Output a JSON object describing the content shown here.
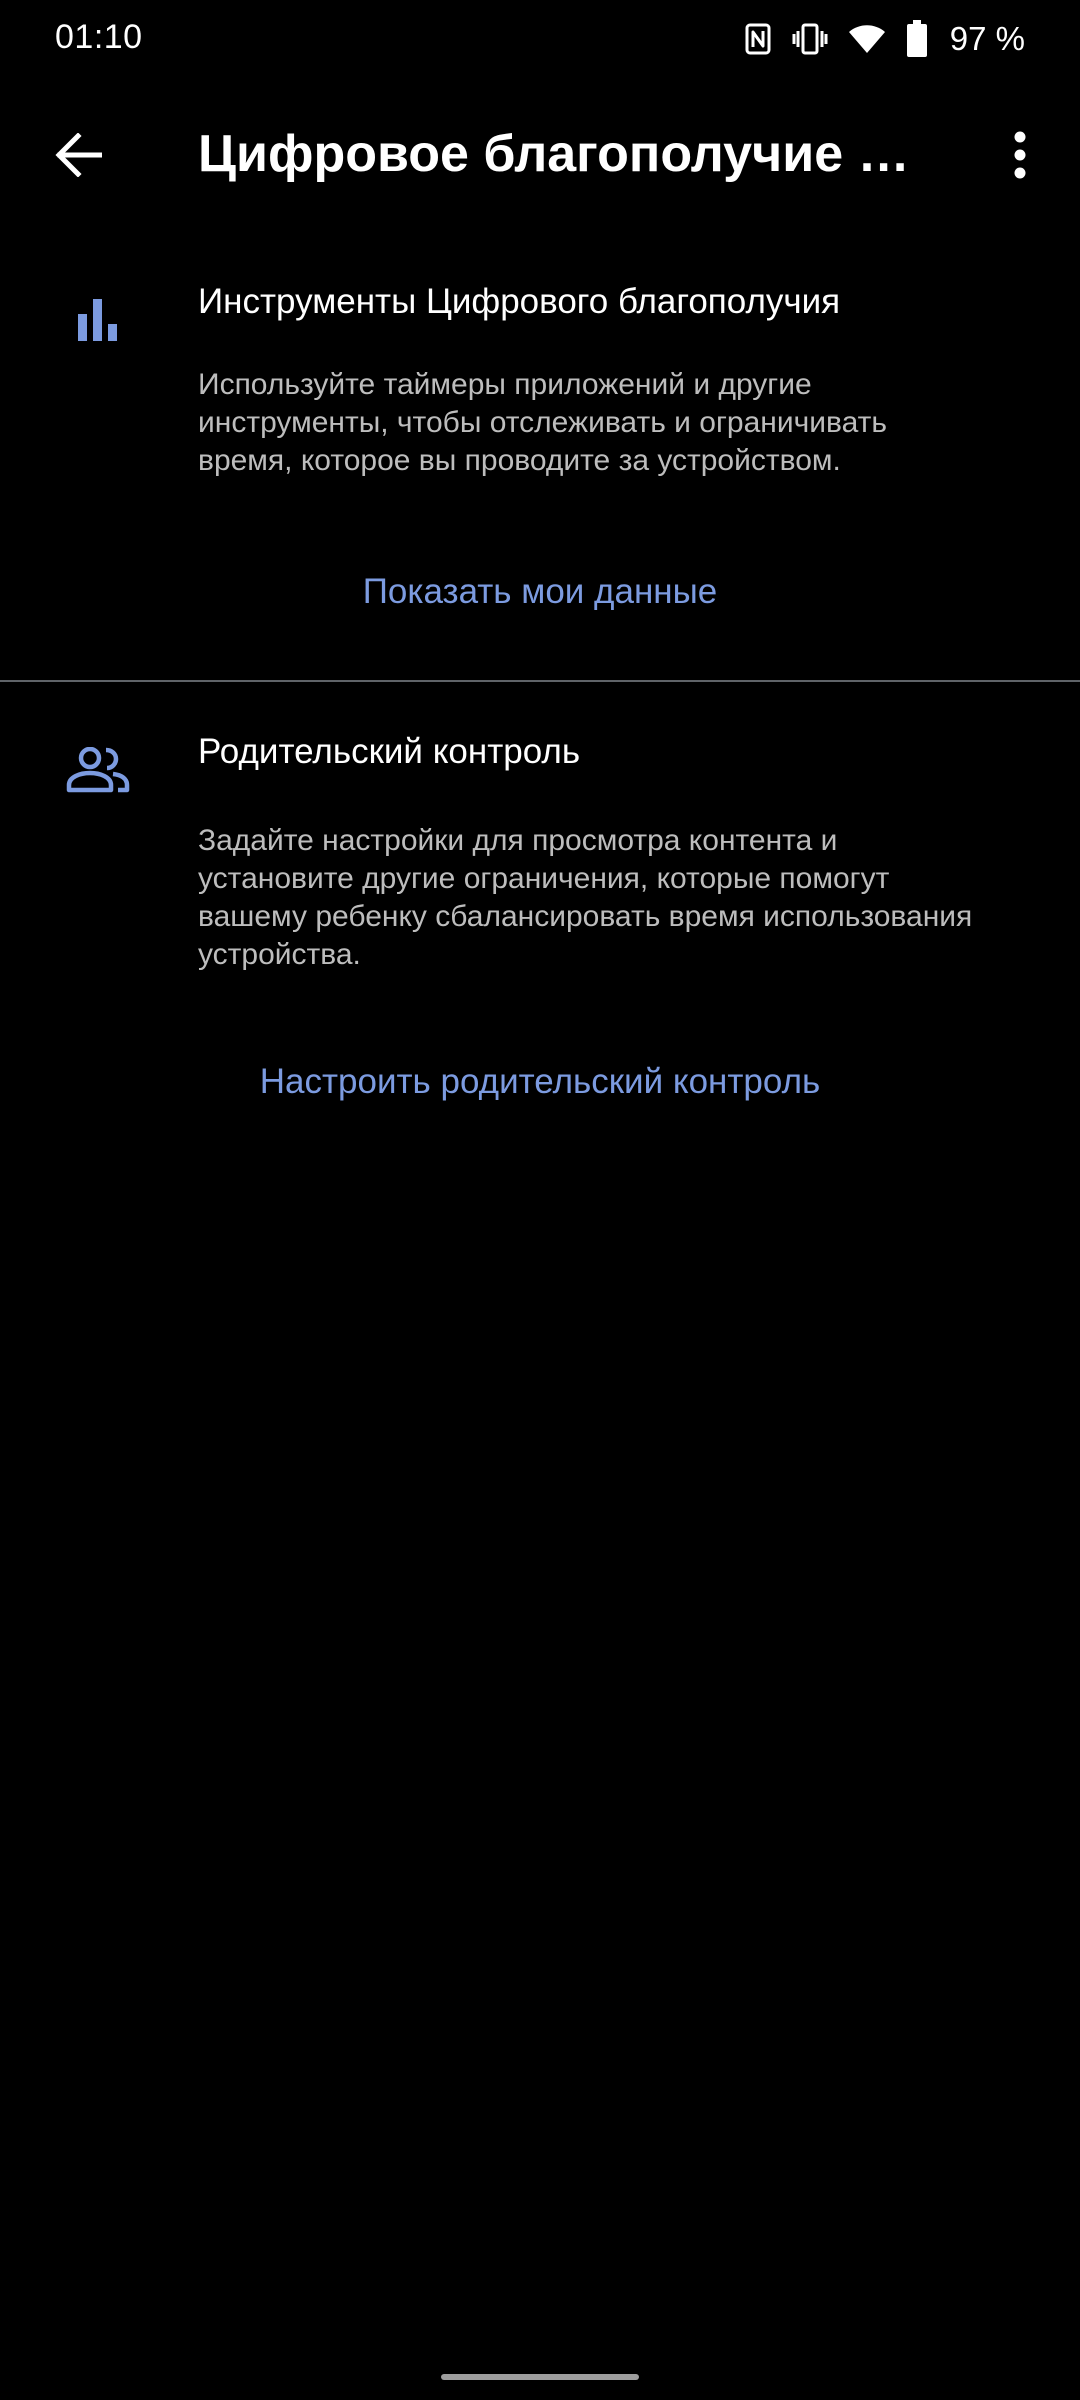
{
  "status_bar": {
    "time": "01:10",
    "battery_percent": "97 %",
    "icons": [
      "nfc-icon",
      "vibrate-icon",
      "wifi-icon",
      "battery-icon"
    ]
  },
  "app_bar": {
    "title": "Цифровое благополучие и…",
    "back_icon": "arrow-back-icon",
    "more_icon": "more-vert-icon"
  },
  "sections": [
    {
      "icon": "bar-chart-icon",
      "title": "Инструменты Цифрового благополучия",
      "description": "Используйте таймеры приложений и другие инструменты, чтобы отслеживать и ограничивать время, которое вы проводите за устройством.",
      "action_label": "Показать мои данные"
    },
    {
      "icon": "people-icon",
      "title": "Родительский контроль",
      "description": "Задайте настройки для просмотра контента и установите другие ограничения, которые помогут вашему ребенку сбалансировать время использования устройства.",
      "action_label": "Настроить родительский контроль"
    }
  ],
  "colors": {
    "background": "#000000",
    "accent": "#7c9be0",
    "secondary_text": "#bdbdbd",
    "divider": "#5f6368"
  }
}
